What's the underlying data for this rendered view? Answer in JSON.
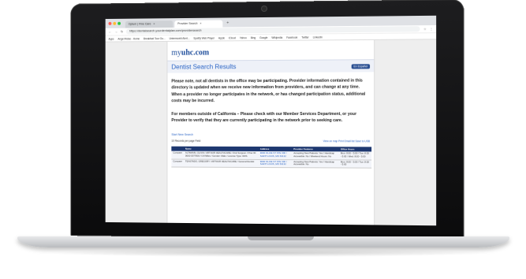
{
  "browser": {
    "tabs": [
      {
        "label": "Optum | Fine Care",
        "close": "×"
      },
      {
        "label": "Provider Search",
        "close": "×"
      }
    ],
    "new_tab": "+",
    "address": "https://dentalsearch.yourdentalplan.com/providersearch",
    "bookmarks": [
      "Apps",
      "Angel Reise - Home",
      "Breakfast Tour Gu...",
      "Untermoebl Alert...",
      "Spotify Web Player",
      "Apple",
      "iCloud",
      "Yahoo",
      "Bing",
      "Google",
      "Wikipedia",
      "Facebook",
      "Twitter",
      "LinkedIn"
    ]
  },
  "site": {
    "logo_prefix": "my",
    "logo_main": "uhc.com",
    "page_title": "Dentist Search Results",
    "espanol": "En Español"
  },
  "notice": {
    "para1": "Please note, not all dentists in the office may be participating. Provider information contained in this directory is updated when we receive new information from providers, and can change at any time. When a provider no longer participates in the network, or has changed participation status, additional costs may be incurred.",
    "para2": "For members outside of California – Please check with our Member Services Department, or your Provider to verify that they are currently participating in the network prior to seeking care."
  },
  "results": {
    "start_new": "Start New Search",
    "records_label": "Records per page",
    "records_value": "10",
    "field_label": "Field",
    "actions": "View on map  Print  Email list  Save to USB",
    "columns": [
      "",
      "Name",
      "Address",
      "Provider Features",
      "Office Hours"
    ],
    "rows": [
      {
        "select": "Compare",
        "name": "ALTMANN, OLIVIA / ARTHUR HEALTHCARE / Oral Surgeon / Prac ID: 0000 0377000 / 0.8 Miles / Gender: Male / License Type: DDS",
        "address": "9000 OLIVE ST STE 300 / SAINT LOUIS, MO 63132",
        "features": "Accepting New Patients: Yes / Handicap Accessible: No / Weekend Hours: No",
        "hours": "Mon: 8:00 - 5:00 / Tue: 8:00 - 5:00 / Wed: 8:00 - 5:00"
      },
      {
        "select": "Compare",
        "name": "TEASTADO, GREGORY / ARTHUR HEALTHCARE / General Dentist",
        "address": "9000 OLIVE ST STE 300 / SAINT LOUIS, MO 63132",
        "features": "Accepting New Patients: Yes / Handicap Accessible: No",
        "hours": "Mon: 8:00 - 5:00 / Tue: 8:00 - 5:00"
      }
    ]
  },
  "colors": {
    "brand_blue": "#1f4e9c",
    "header_navy": "#1e3870",
    "link_blue": "#2a64c5"
  }
}
